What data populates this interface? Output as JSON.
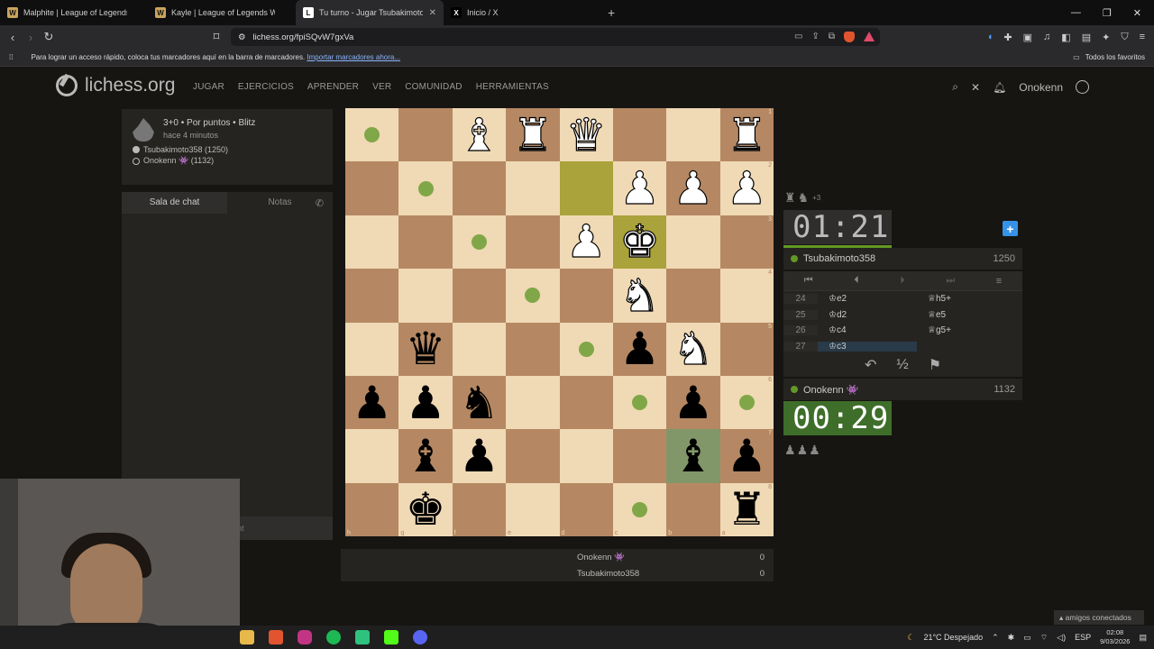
{
  "browser": {
    "tabs": [
      {
        "label": "Malphite | League of Legends Wiki",
        "icon": "W"
      },
      {
        "label": "Kayle | League of Legends Wiki",
        "icon": "W"
      },
      {
        "label": "Tu turno - Jugar Tsubakimoto",
        "icon": "L",
        "active": true
      },
      {
        "label": "Inicio / X",
        "icon": "X"
      }
    ],
    "url": "lichess.org/fpiSQvW7gxVa",
    "bookmarks_hint": "Para lograr un acceso rápido, coloca tus marcadores aquí en la barra de marcadores.",
    "bookmarks_link": "Importar marcadores ahora...",
    "all_bookmarks": "Todos los favoritos"
  },
  "site": {
    "brand": "lichess.org",
    "nav": [
      "JUGAR",
      "EJERCICIOS",
      "APRENDER",
      "VER",
      "COMUNIDAD",
      "HERRAMIENTAS"
    ],
    "username": "Onokenn"
  },
  "game": {
    "type": "3+0 • Por puntos • Blitz",
    "started": "hace 4 minutos",
    "white_player": "Tsubakimoto358 (1250)",
    "black_player": "Onokenn 👾 (1132)"
  },
  "chat": {
    "tab_chat": "Sala de chat",
    "tab_notes": "Notas",
    "input_fragment": "nt"
  },
  "opponent": {
    "name": "Tsubakimoto358",
    "rating": "1250",
    "clock": "01:21",
    "material": "+3"
  },
  "me": {
    "name": "Onokenn 👾",
    "rating": "1132",
    "clock": "00:29"
  },
  "moves": [
    {
      "n": "24",
      "w": "♔e2",
      "b": "♕h5+"
    },
    {
      "n": "25",
      "w": "♔d2",
      "b": "♕e5"
    },
    {
      "n": "26",
      "w": "♔c4",
      "b": "♕g5+"
    },
    {
      "n": "27",
      "w": "♔c3",
      "b": ""
    }
  ],
  "actions": {
    "takeback": "↶",
    "draw": "½",
    "resign": "⚑"
  },
  "scoreboard": [
    {
      "name": "Onokenn 👾",
      "score": "0"
    },
    {
      "name": "Tsubakimoto358",
      "score": "0"
    }
  ],
  "board": {
    "rows": [
      [
        "dot",
        "",
        "wB",
        "wR",
        "wQ",
        "",
        "",
        "wR"
      ],
      [
        "",
        "dot",
        "",
        "",
        "HL",
        "wP",
        "wP",
        "wP"
      ],
      [
        "",
        "",
        "dot",
        "",
        "wP",
        "wK*",
        "",
        ""
      ],
      [
        "",
        "",
        "",
        "dot",
        "",
        "wN",
        "",
        ""
      ],
      [
        "",
        "bQ",
        "",
        "",
        "dot",
        "bP",
        "wN",
        ""
      ],
      [
        "bP",
        "bP",
        "bN",
        "",
        "",
        "dot",
        "bP",
        "dot"
      ],
      [
        "",
        "bB",
        "bP",
        "",
        "",
        "",
        "bB*",
        "bP"
      ],
      [
        "",
        "bK",
        "",
        "",
        "",
        "dot",
        "",
        "bR"
      ]
    ],
    "rank_labels": [
      "1",
      "2",
      "3",
      "4",
      "5",
      "6",
      "7",
      "8"
    ],
    "file_labels": [
      "h",
      "g",
      "f",
      "e",
      "d",
      "c",
      "b",
      "a"
    ]
  },
  "taskbar": {
    "weather": "21°C Despejado",
    "lang": "ESP",
    "time": "02:08",
    "date": "9/03/2026",
    "friends": "amigos conectados"
  }
}
